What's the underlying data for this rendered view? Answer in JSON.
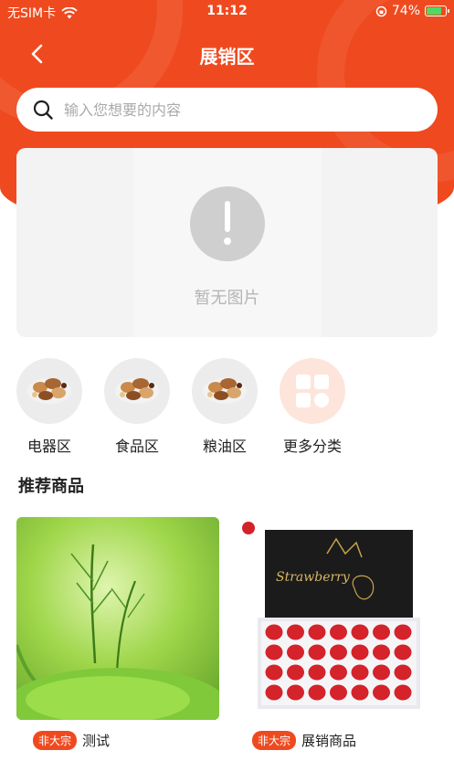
{
  "status_bar": {
    "carrier": "无SIM卡",
    "time": "11:12",
    "battery": "74%"
  },
  "header": {
    "title": "展销区"
  },
  "search": {
    "placeholder": "输入您想要的内容"
  },
  "banner": {
    "empty_text": "暂无图片"
  },
  "categories": [
    {
      "label": "电器区",
      "icon": "nuts-image"
    },
    {
      "label": "食品区",
      "icon": "nuts-image"
    },
    {
      "label": "粮油区",
      "icon": "nuts-image"
    },
    {
      "label": "更多分类",
      "icon": "grid-icon"
    }
  ],
  "section": {
    "title": "推荐商品"
  },
  "products": [
    {
      "badge": "非大宗",
      "name": "测试",
      "image": "sprout-photo"
    },
    {
      "badge": "非大宗",
      "name": "展销商品",
      "image": "strawberry-box-photo",
      "box_text": "Strawberry"
    }
  ],
  "colors": {
    "brand": "#ef4a1f",
    "more_bg": "#fde5dc"
  }
}
